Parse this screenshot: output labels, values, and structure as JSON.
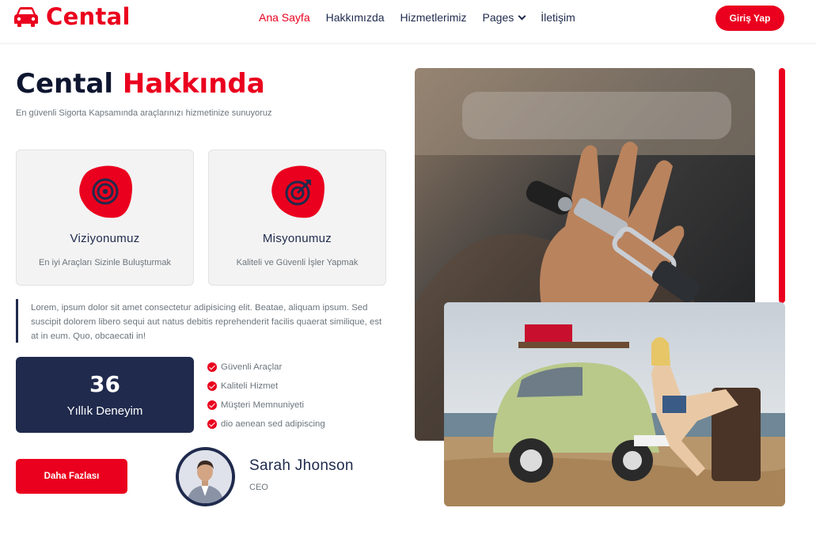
{
  "brand": {
    "name": "Cental",
    "icon": "car-icon",
    "color": "#ea001e"
  },
  "nav": {
    "items": [
      {
        "label": "Ana Sayfa",
        "active": true
      },
      {
        "label": "Hakkımızda",
        "active": false
      },
      {
        "label": "Hizmetlerimiz",
        "active": false
      },
      {
        "label": "Pages",
        "active": false,
        "dropdown": true
      },
      {
        "label": "İletişim",
        "active": false
      }
    ],
    "login_label": "Giriş Yap"
  },
  "about": {
    "title_main": "Cental",
    "title_accent": "Hakkında",
    "subtitle": "En güvenli Sigorta Kapsamında araçlarınızı hizmetinize sunuyoruz",
    "cards": [
      {
        "icon": "target-icon",
        "title": "Viziyonumuz",
        "text": "En iyi Araçları Sizinle Buluşturmak"
      },
      {
        "icon": "target-arrow-icon",
        "title": "Misyonumuz",
        "text": "Kaliteli ve Güvenli İşler Yapmak"
      }
    ],
    "quote": "Lorem, ipsum dolor sit amet consectetur adipisicing elit. Beatae, aliquam ipsum. Sed suscipit dolorem libero sequi aut natus debitis reprehenderit facilis quaerat similique, est at in eum. Quo, obcaecati in!",
    "experience": {
      "number": "36",
      "label": "Yıllık Deneyim"
    },
    "checklist": [
      "Güvenli Araçlar",
      "Kaliteli Hizmet",
      "Müşteri Memnuniyeti",
      "dio aenean sed adipiscing"
    ],
    "more_label": "Daha Fazlası",
    "person": {
      "name": "Sarah Jhonson",
      "role": "CEO"
    }
  },
  "colors": {
    "accent": "#ea001e",
    "navy": "#1f2a4d",
    "muted": "#6c757d"
  }
}
